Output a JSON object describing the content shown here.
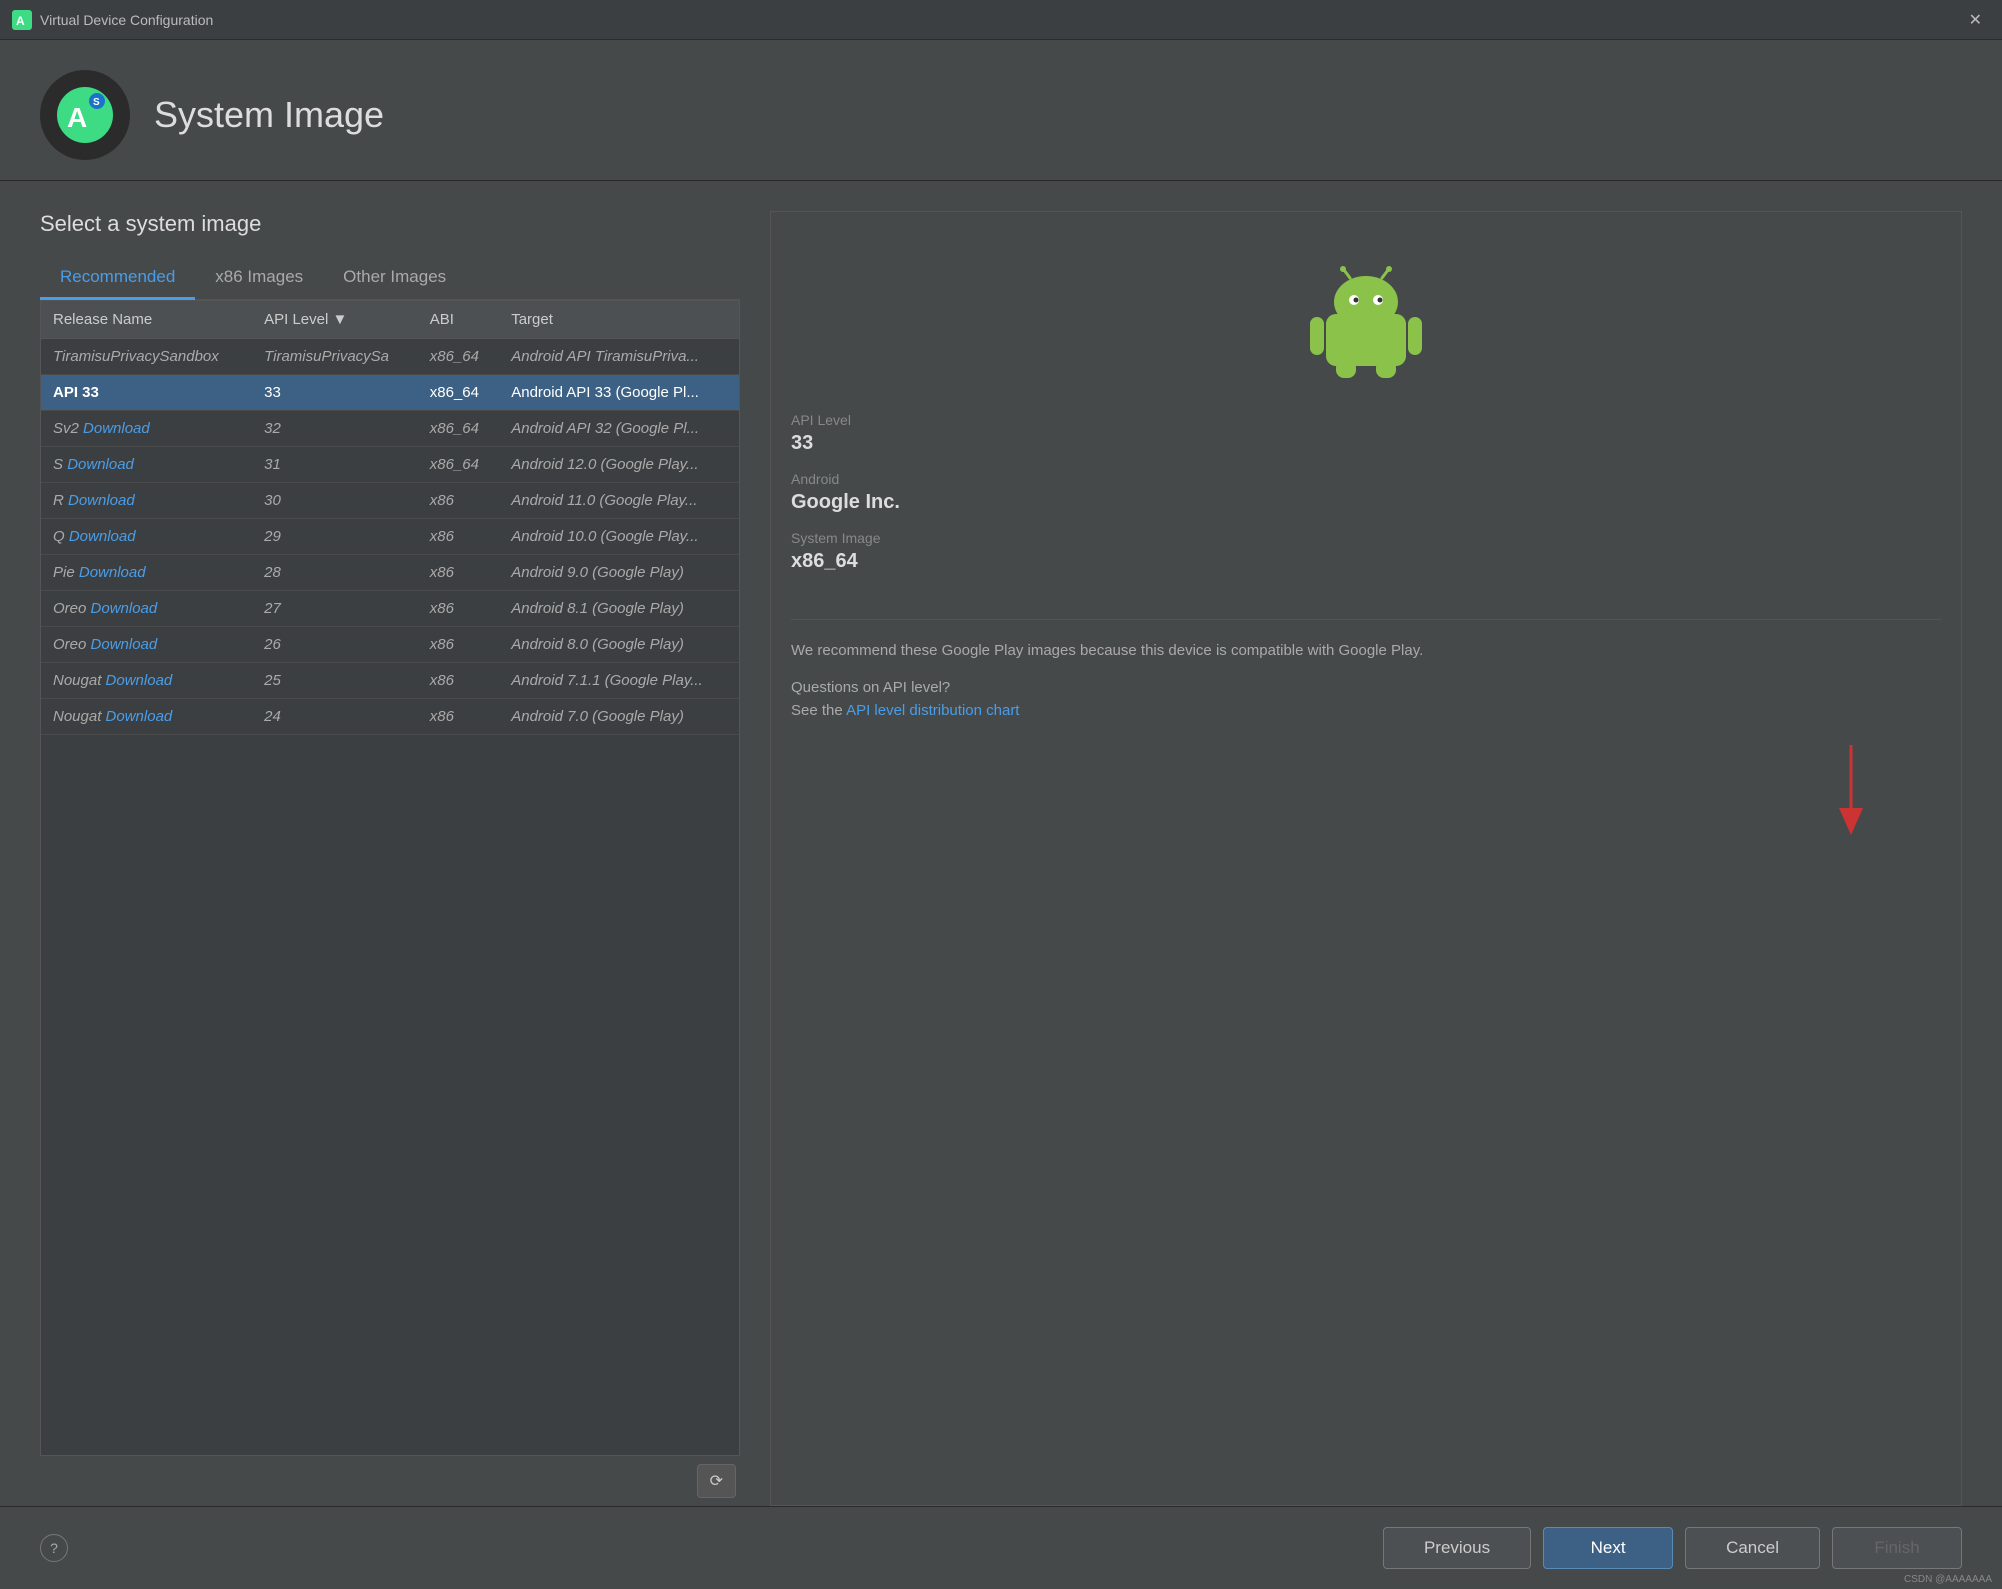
{
  "window": {
    "title": "Virtual Device Configuration",
    "close_label": "✕"
  },
  "header": {
    "title": "System Image",
    "icon_alt": "Android Studio Icon"
  },
  "content": {
    "select_label": "Select a system image",
    "tabs": [
      {
        "id": "recommended",
        "label": "Recommended",
        "active": true
      },
      {
        "id": "x86images",
        "label": "x86 Images",
        "active": false
      },
      {
        "id": "otherimages",
        "label": "Other Images",
        "active": false
      }
    ],
    "table": {
      "columns": [
        {
          "id": "release_name",
          "label": "Release Name"
        },
        {
          "id": "api_level",
          "label": "API Level ▼"
        },
        {
          "id": "abi",
          "label": "ABI"
        },
        {
          "id": "target",
          "label": "Target"
        }
      ],
      "rows": [
        {
          "release_name": "TiramisuPrivacySandbox",
          "api_level": "TiramisuPrivacySa",
          "abi": "x86_64",
          "target": "Android API TiramisuPriva...",
          "selected": false,
          "italic": true,
          "has_download": false
        },
        {
          "release_name": "API 33",
          "api_level": "33",
          "abi": "x86_64",
          "target": "Android API 33 (Google Pl...",
          "selected": true,
          "italic": false,
          "has_download": false
        },
        {
          "release_name": "Sv2",
          "api_level": "32",
          "abi": "x86_64",
          "target": "Android API 32 (Google Pl...",
          "selected": false,
          "italic": true,
          "has_download": true,
          "release_prefix": "Sv2"
        },
        {
          "release_name": "S",
          "api_level": "31",
          "abi": "x86_64",
          "target": "Android 12.0 (Google Play...",
          "selected": false,
          "italic": true,
          "has_download": true,
          "release_prefix": "S"
        },
        {
          "release_name": "R",
          "api_level": "30",
          "abi": "x86",
          "target": "Android 11.0 (Google Play...",
          "selected": false,
          "italic": true,
          "has_download": true,
          "release_prefix": "R"
        },
        {
          "release_name": "Q",
          "api_level": "29",
          "abi": "x86",
          "target": "Android 10.0 (Google Play...",
          "selected": false,
          "italic": true,
          "has_download": true,
          "release_prefix": "Q"
        },
        {
          "release_name": "Pie",
          "api_level": "28",
          "abi": "x86",
          "target": "Android 9.0 (Google Play)",
          "selected": false,
          "italic": true,
          "has_download": true,
          "release_prefix": "Pie"
        },
        {
          "release_name": "Oreo",
          "api_level": "27",
          "abi": "x86",
          "target": "Android 8.1 (Google Play)",
          "selected": false,
          "italic": true,
          "has_download": true,
          "release_prefix": "Oreo"
        },
        {
          "release_name": "Oreo",
          "api_level": "26",
          "abi": "x86",
          "target": "Android 8.0 (Google Play)",
          "selected": false,
          "italic": true,
          "has_download": true,
          "release_prefix": "Oreo"
        },
        {
          "release_name": "Nougat",
          "api_level": "25",
          "abi": "x86",
          "target": "Android 7.1.1 (Google Play...",
          "selected": false,
          "italic": true,
          "has_download": true,
          "release_prefix": "Nougat"
        },
        {
          "release_name": "Nougat",
          "api_level": "24",
          "abi": "x86",
          "target": "Android 7.0 (Google Play)",
          "selected": false,
          "italic": true,
          "has_download": true,
          "release_prefix": "Nougat"
        }
      ]
    }
  },
  "right_panel": {
    "api_level_label": "API Level",
    "api_level_value": "33",
    "android_label": "Android",
    "android_value": "Google Inc.",
    "system_image_label": "System Image",
    "system_image_value": "x86_64",
    "recommend_text": "We recommend these Google Play images because this device is compatible with Google Play.",
    "api_question": "Questions on API level?",
    "api_see": "See the ",
    "api_link_text": "API level distribution chart"
  },
  "buttons": {
    "previous": "Previous",
    "next": "Next",
    "cancel": "Cancel",
    "finish": "Finish",
    "help": "?",
    "refresh_icon": "⟳"
  },
  "download_label": "Download"
}
